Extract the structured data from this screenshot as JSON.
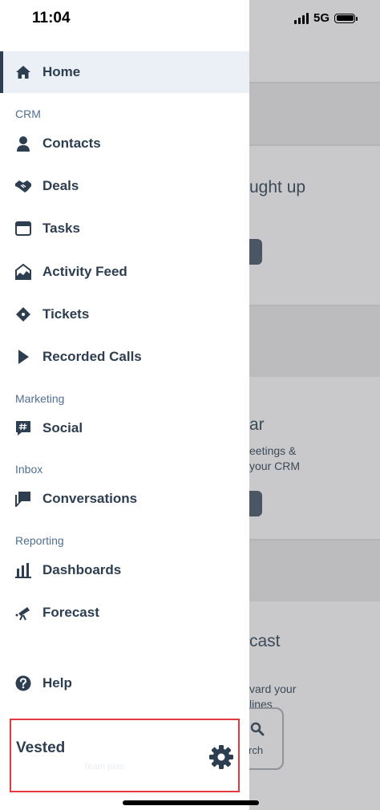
{
  "status_bar": {
    "time": "11:04",
    "network": "5G",
    "icons": {
      "signal": "signal-bars-icon",
      "battery": "battery-icon"
    }
  },
  "drawer": {
    "items": [
      {
        "id": "home",
        "label": "Home",
        "icon": "home-icon",
        "active": true
      },
      {
        "id": "contacts",
        "label": "Contacts",
        "icon": "person-icon"
      },
      {
        "id": "deals",
        "label": "Deals",
        "icon": "handshake-icon"
      },
      {
        "id": "tasks",
        "label": "Tasks",
        "icon": "tasks-icon"
      },
      {
        "id": "activity-feed",
        "label": "Activity Feed",
        "icon": "activity-icon"
      },
      {
        "id": "tickets",
        "label": "Tickets",
        "icon": "ticket-icon"
      },
      {
        "id": "recorded-calls",
        "label": "Recorded Calls",
        "icon": "play-icon"
      },
      {
        "id": "social",
        "label": "Social",
        "icon": "hashtag-icon"
      },
      {
        "id": "conversations",
        "label": "Conversations",
        "icon": "chat-icon"
      },
      {
        "id": "dashboards",
        "label": "Dashboards",
        "icon": "bar-chart-icon"
      },
      {
        "id": "forecast",
        "label": "Forecast",
        "icon": "telescope-icon"
      },
      {
        "id": "help",
        "label": "Help",
        "icon": "help-icon"
      }
    ],
    "sections": {
      "crm": "CRM",
      "marketing": "Marketing",
      "inbox": "Inbox",
      "reporting": "Reporting"
    },
    "account": {
      "name": "Vested",
      "subtitle": "Team plan",
      "settings_icon": "gear-icon"
    }
  },
  "background": {
    "card1_title": "ught up",
    "card2_title": "ar",
    "card2_line1": "eetings &",
    "card2_line2": "your CRM",
    "card3_title": "cast",
    "card3_line1": "vard your",
    "card3_line2": "lines",
    "card3_button": "rch",
    "card3_button_icon": "search-icon"
  },
  "colors": {
    "accent": "#2d3e50",
    "active_bg": "#eaf0f6",
    "section_text": "#516f90",
    "highlight_border": "#e0393e"
  }
}
